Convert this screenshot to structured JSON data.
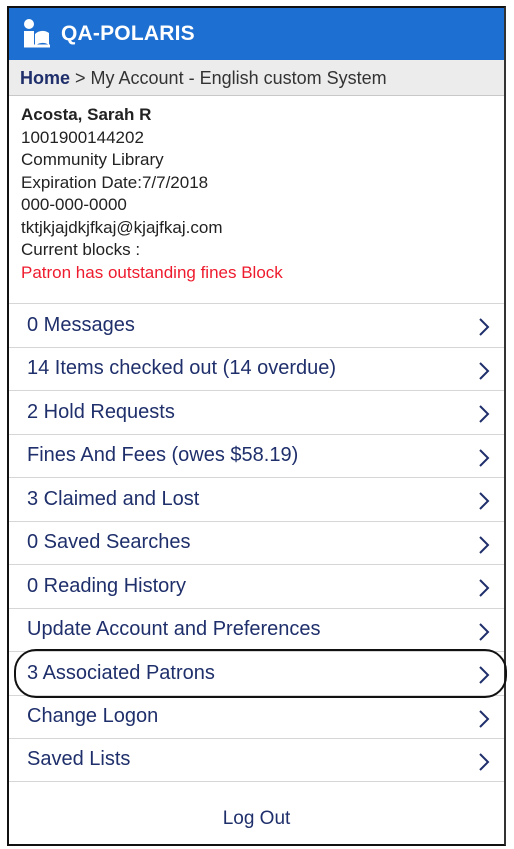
{
  "header": {
    "title": "QA-POLARIS",
    "logo_icon": "library-reader-icon"
  },
  "breadcrumb": {
    "home": "Home",
    "rest": " > My Account - English custom System"
  },
  "patron": {
    "name": "Acosta, Sarah R",
    "barcode": "1001900144202",
    "library": "Community Library",
    "expiration": "Expiration Date:7/7/2018",
    "phone": "000-000-0000",
    "email": "tktjkjajdkjfkaj@kjajfkaj.com",
    "blocks_label": "Current blocks :",
    "block_message": "Patron has outstanding fines Block"
  },
  "menu": {
    "items": [
      {
        "label": "0 Messages"
      },
      {
        "label": "14 Items checked out (14 overdue)"
      },
      {
        "label": "2 Hold Requests"
      },
      {
        "label": "Fines And Fees (owes $58.19)"
      },
      {
        "label": "3 Claimed and Lost"
      },
      {
        "label": "0 Saved Searches"
      },
      {
        "label": "0 Reading History"
      },
      {
        "label": "Update Account and Preferences"
      },
      {
        "label": "3 Associated Patrons"
      },
      {
        "label": "Change Logon"
      },
      {
        "label": "Saved Lists"
      }
    ]
  },
  "logout": "Log Out",
  "colors": {
    "brand": "#1d6fd1",
    "link": "#1f2f6b",
    "alert": "#ee1b2e"
  }
}
